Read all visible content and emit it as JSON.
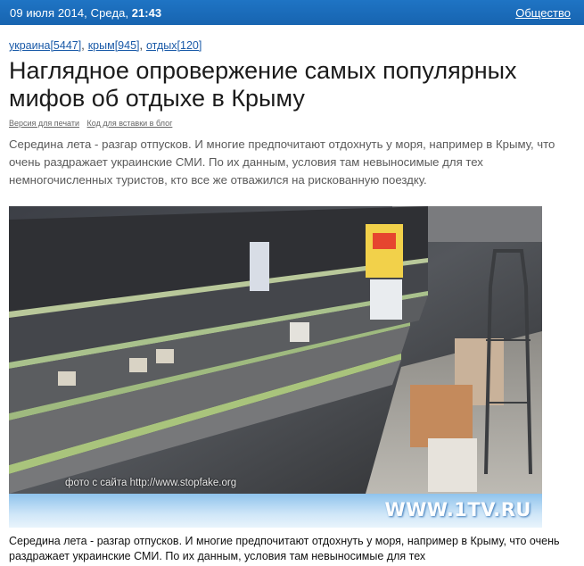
{
  "header": {
    "date": "09 июля 2014, Среда,",
    "time": "21:43",
    "section_link": "Общество"
  },
  "tags": [
    {
      "label": "украина[5447]"
    },
    {
      "label": "крым[945]"
    },
    {
      "label": "отдых[120]"
    }
  ],
  "article": {
    "title": "Наглядное опровержение самых популярных мифов об отдыхе в Крыму",
    "print_link": "Версия для печати",
    "embed_link": "Код для вставки в блог",
    "lead": "Середина лета - разгар отпусков. И многие предпочитают отдохнуть у моря, например в Крыму, что очень раздражает украинские СМИ. По их данным, условия там невыносимые для тех немногочисленных туристов, кто все же отважился на рискованную поездку.",
    "photo_credit": "фото с сайта http://www.stopfake.org",
    "photo_logo": "WWW.1TV.RU",
    "body": "Середина лета - разгар отпусков. И многие предпочитают отдохнуть у моря, например в Крыму, что очень раздражает украинские СМИ. По их данным, условия там невыносимые для тех"
  }
}
